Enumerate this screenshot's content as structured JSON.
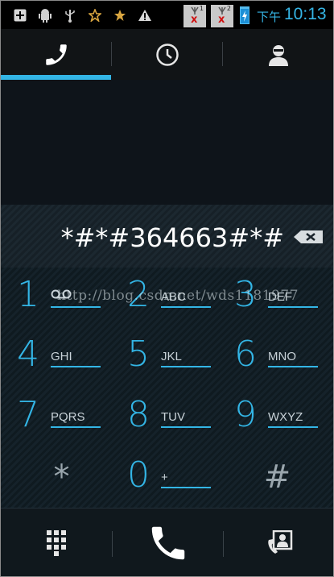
{
  "status_bar": {
    "sim1_label": "1",
    "sim2_label": "2",
    "sim_no_signal": "x",
    "time_prefix": "下午",
    "time": "10:13",
    "icons": [
      "add-icon",
      "android-debug-icon",
      "usb-icon",
      "star-outline-icon",
      "star-icon",
      "warning-icon",
      "sim1-signal-icon",
      "sim2-signal-icon",
      "battery-charging-icon"
    ]
  },
  "tabs": [
    {
      "name": "phone",
      "icon": "phone-icon",
      "selected": true
    },
    {
      "name": "call-log",
      "icon": "clock-icon",
      "selected": false
    },
    {
      "name": "contacts",
      "icon": "contact-icon",
      "selected": false
    }
  ],
  "dialer": {
    "digits": "*#*#364663#*#",
    "backspace_icon": "backspace-icon"
  },
  "keypad": {
    "keys": [
      {
        "num": "1",
        "letters": "oo"
      },
      {
        "num": "2",
        "letters": "ABC"
      },
      {
        "num": "3",
        "letters": "DEF"
      },
      {
        "num": "4",
        "letters": "GHI"
      },
      {
        "num": "5",
        "letters": "JKL"
      },
      {
        "num": "6",
        "letters": "MNO"
      },
      {
        "num": "7",
        "letters": "PQRS"
      },
      {
        "num": "8",
        "letters": "TUV"
      },
      {
        "num": "9",
        "letters": "WXYZ"
      },
      {
        "num": "*",
        "letters": ""
      },
      {
        "num": "0",
        "letters": "+"
      },
      {
        "num": "#",
        "letters": ""
      }
    ],
    "watermark": "http://blog.csdn.net/wds1181977"
  },
  "bottom_bar": {
    "buttons": [
      "dialpad-icon",
      "call-icon",
      "contacts-card-icon"
    ]
  },
  "colors": {
    "accent": "#33b5e5",
    "background": "#0c1217",
    "status_bar": "#000000"
  }
}
